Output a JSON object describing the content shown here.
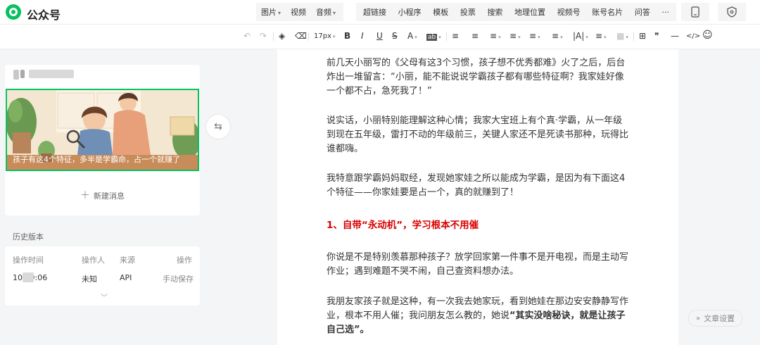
{
  "app": {
    "brand": "公众号"
  },
  "header": {
    "insert_menu": [
      {
        "label": "图片",
        "dropdown": true
      },
      {
        "label": "视频",
        "dropdown": false
      },
      {
        "label": "音频",
        "dropdown": true
      }
    ],
    "widget_menu": [
      "超链接",
      "小程序",
      "模板",
      "投票",
      "搜索",
      "地理位置",
      "视频号",
      "账号名片",
      "问答",
      "···"
    ]
  },
  "toolbar": {
    "undo_icon": "↶",
    "redo_icon": "↷",
    "format_painter_icon": "◈",
    "clear_format_icon": "⌫",
    "font_size": "17px",
    "bold": "B",
    "italic": "I",
    "underline": "U",
    "strikethrough": "S",
    "font_color": "A",
    "bg_color": "ab",
    "align_icon": "≡",
    "quote_icon": "❞",
    "hr_icon": "—",
    "code_icon": "</>",
    "emoji_icon": "☺"
  },
  "sidebar": {
    "article": {
      "cover_caption": "孩子有这4个特征，多半是学霸命，占一个就赚了"
    },
    "new_message": "新建消息",
    "history": {
      "title": "历史版本",
      "headers": [
        "操作时间",
        "操作人",
        "来源",
        "操作"
      ],
      "rows": [
        {
          "time": "10 19:06",
          "operator": "未知",
          "source": "API",
          "action": "手动保存"
        }
      ]
    }
  },
  "editor": {
    "paragraphs": [
      "前几天小丽写的《父母有这3个习惯，孩子想不优秀都难》火了之后，后台炸出一堆留言：“小丽，能不能说说学霸孩子都有哪些特征啊？我家娃好像一个都不占，急死我了！”",
      "说实话，小丽特别能理解这种心情；我家大宝班上有个真·学霸，从一年级到现在五年级，雷打不动的年级前三，关键人家还不是死读书那种，玩得比谁都嗨。",
      "我特意跟学霸妈妈取经，发现她家娃之所以能成为学霸，是因为有下面这4个特征——你家娃要是占一个，真的就赚到了！",
      "1、自带“永动机”，学习根本不用催",
      "你说是不是特别羡慕那种孩子？放学回家第一件事不是开电视，而是主动写作业；遇到难题不哭不闹，自己查资料想办法。",
      "我朋友家孩子就是这种，有一次我去她家玩，看到她娃在那边安安静静写作业，根本不用人催；我问朋友怎么教的，她说"
    ],
    "quote_bold": "“其实没啥秘诀，就是让孩子自己选”。"
  },
  "article_settings": "文章设置",
  "colors": {
    "accent": "#07c160",
    "heading_red": "#d90000"
  }
}
